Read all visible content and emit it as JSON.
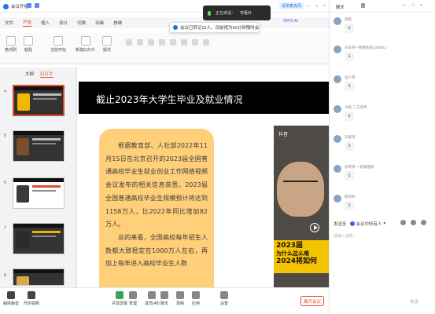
{
  "meeting": {
    "app_title": "会议开始",
    "speaking_label": "正在讲话：",
    "speaker_name": "李雁红",
    "timer_badge": "请求麦克风",
    "user_name": "成员(48)"
  },
  "wps": {
    "tabs": [
      "文件",
      "开始",
      "插入",
      "设计",
      "切换",
      "动画",
      "放映"
    ],
    "active_tab": "开始",
    "notice": "会议已转记22人，目前视为60分钟限时会议。",
    "ai_label": "WPS AI",
    "ribbon": {
      "format_painter": "格式刷",
      "paste": "粘贴",
      "current_slide": "当前开始",
      "new_slide": "新建幻灯片",
      "layout": "版式"
    },
    "panel_tabs": [
      "大纲",
      "幻灯片"
    ],
    "slide_numbers": [
      "4",
      "5",
      "6",
      "7",
      "8"
    ]
  },
  "slide": {
    "title": "截止2023年大学生毕业及就业情况",
    "paragraphs": [
      "根据教育部、人社部2022年11月15日在北京召开的2023届全国普通高校毕业生就业创业工作网络视频会议发布的相关信息获悉，2023届全国普通高校毕业生规模预计将达到1158万人，比2022年同比增加82万人。",
      "总的来看，全国高校每年招生人数都大致稳定在1000万人左右，再加上每年进入高校毕业生人数"
    ],
    "video": {
      "watermark": "抖音",
      "caption_l1": "2023届",
      "caption_l2": "为什么这么难",
      "caption_l3": "2024将如何"
    }
  },
  "bottom_bar": {
    "items": [
      "解除静音",
      "开启视频",
      "共享屏幕",
      "管理",
      "成员(48)",
      "聊天",
      "录制",
      "应用",
      "设置"
    ],
    "end_button": "离开会议"
  },
  "chat": {
    "title": "聊天",
    "window_controls": [
      "—",
      "□",
      "×"
    ],
    "messages": [
      {
        "name": "高晓",
        "text": "1"
      },
      {
        "name": "邓志琴一明朗主班2300612",
        "text": "1"
      },
      {
        "name": "张小琴",
        "text": "1"
      },
      {
        "name": "大班·二王老师",
        "text": "1"
      },
      {
        "name": "刘富琼",
        "text": "1"
      },
      {
        "name": "凉宵雨·一班葛慧丽",
        "text": "1"
      },
      {
        "name": "陈利利",
        "text": "1"
      }
    ],
    "send_to_label": "发送至",
    "send_to_target": "会议中所有人",
    "input_placeholder": "请输入消息...",
    "send_button": "发送"
  }
}
